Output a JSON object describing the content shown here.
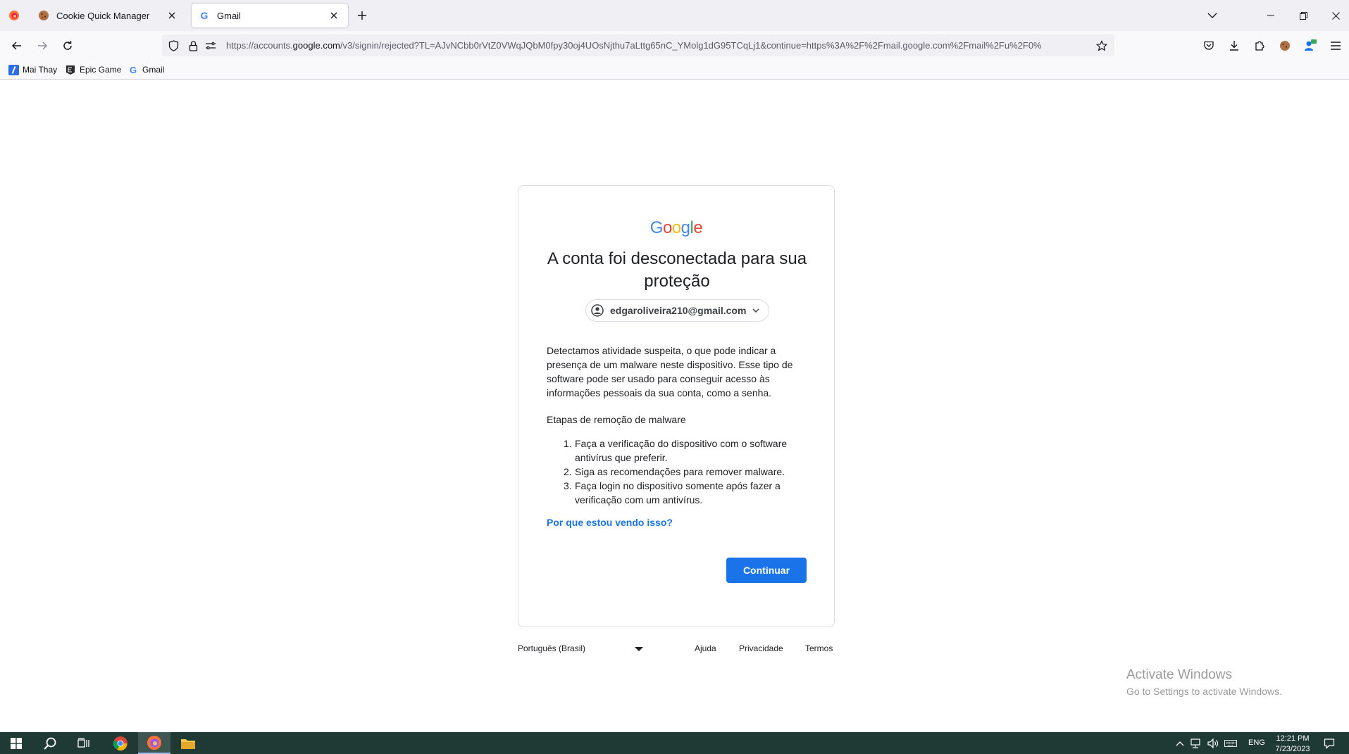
{
  "browser": {
    "tabs": [
      {
        "title": "Cookie Quick Manager",
        "active": false
      },
      {
        "title": "Gmail",
        "active": true
      }
    ],
    "url": {
      "prefix": "https://accounts.",
      "domain": "google.com",
      "rest": "/v3/signin/rejected?TL=AJvNCbb0rVtZ0VWqJQbM0fpy30oj4UOsNjthu7aLttg65nC_YMolg1dG95TCqLj1&continue=https%3A%2F%2Fmail.google.com%2Fmail%2Fu%2F0%"
    },
    "bookmarks": [
      {
        "label": "Mai Thay",
        "icon": "slash-bookmark-icon"
      },
      {
        "label": "Epic Game",
        "icon": "epic-games-icon"
      },
      {
        "label": "Gmail",
        "icon": "google-g-icon"
      }
    ]
  },
  "page": {
    "logo_letters": [
      {
        "char": "G",
        "color": "#4285F4"
      },
      {
        "char": "o",
        "color": "#EA4335"
      },
      {
        "char": "o",
        "color": "#FBBC05"
      },
      {
        "char": "g",
        "color": "#4285F4"
      },
      {
        "char": "l",
        "color": "#34A853"
      },
      {
        "char": "e",
        "color": "#EA4335"
      }
    ],
    "heading": "A conta foi desconectada para sua proteção",
    "account_email": "edgaroliveira210@gmail.com",
    "intro": "Detectamos atividade suspeita, o que pode indicar a presença de um malware neste dispositivo. Esse tipo de software pode ser usado para conseguir acesso às informações pessoais da sua conta, como a senha.",
    "steps_title": "Etapas de remoção de malware",
    "steps": [
      {
        "num": "1.",
        "text": "Faça a verificação do dispositivo com o software antivírus que preferir."
      },
      {
        "num": "2.",
        "text": "Siga as recomendações para remover malware."
      },
      {
        "num": "3.",
        "text": "Faça login no dispositivo somente após fazer a verificação com um antivírus."
      }
    ],
    "why_link": "Por que estou vendo isso?",
    "continue_label": "Continuar",
    "accent_color": "#1a73e8"
  },
  "footer": {
    "language": "Português (Brasil)",
    "links": [
      "Ajuda",
      "Privacidade",
      "Termos"
    ]
  },
  "watermark": {
    "line1": "Activate Windows",
    "line2": "Go to Settings to activate Windows."
  },
  "taskbar": {
    "lang": "ENG",
    "time": "12:21 PM",
    "date": "7/23/2023"
  }
}
